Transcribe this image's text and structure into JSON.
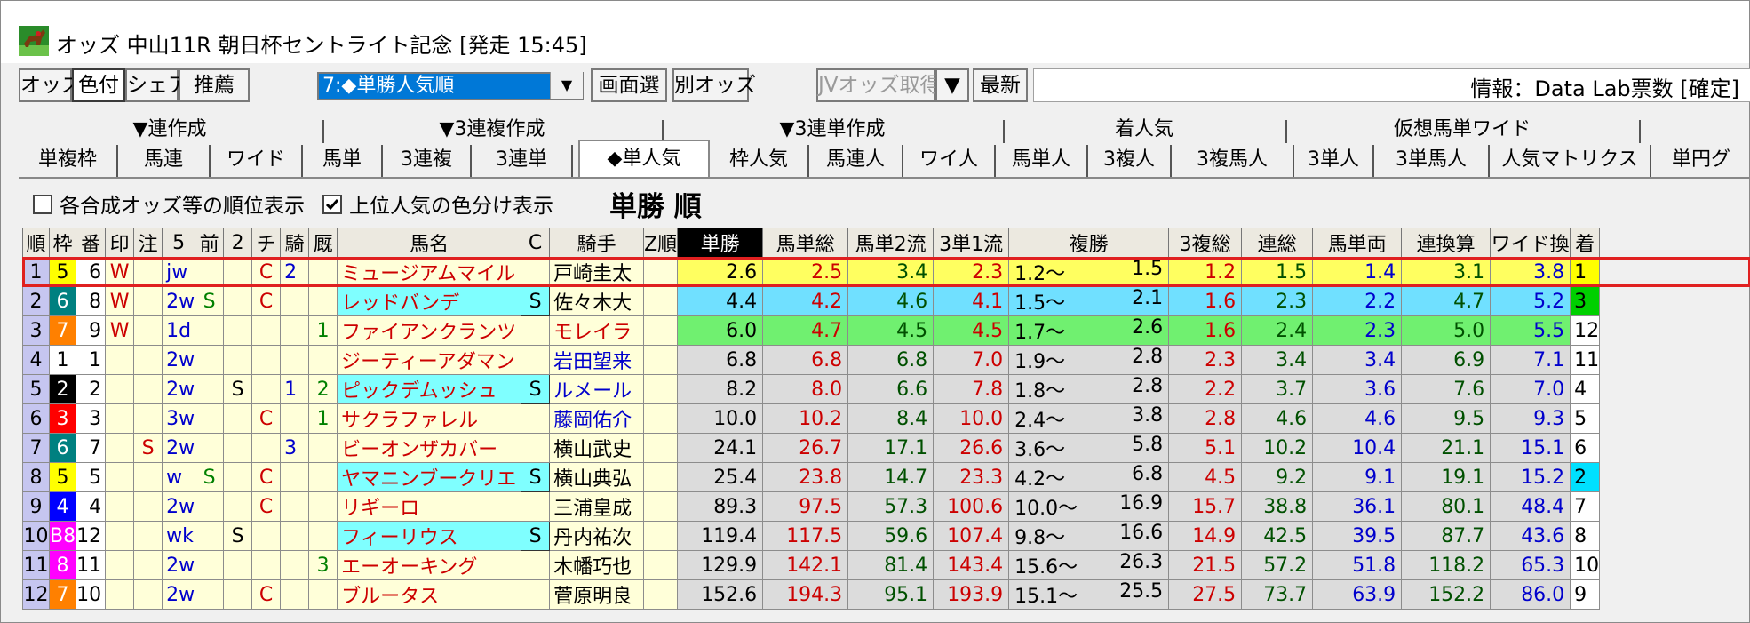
{
  "window": {
    "title": "オッズ 中山11R 朝日杯セントライト記念 [発走 15:45]"
  },
  "toolbar": {
    "buttons": [
      "オッズ",
      "色付",
      "シェア",
      "推薦"
    ],
    "sort_select": "7:◆単勝人気順",
    "screen_select": "画面選",
    "other_odds": "別オッズ",
    "jv_fetch": "JVオッズ取得",
    "dropdown_arrow": "▼",
    "latest": "最新",
    "info": "情報：Data Lab票数 [確定]"
  },
  "tab_groups": [
    "▼連作成",
    "▼3連複作成",
    "▼3連単作成",
    "着人気",
    "仮想馬単ワイド"
  ],
  "tabs": [
    "単複枠",
    "馬連",
    "ワイド",
    "馬単",
    "3連複",
    "3連単",
    "◆単人気",
    "枠人気",
    "馬連人",
    "ワイ人",
    "馬単人",
    "3複人",
    "3複馬人",
    "3単人",
    "3単馬人",
    "人気マトリクス",
    "単円グ"
  ],
  "options": {
    "rank_display": "各合成オッズ等の順位表示",
    "color_display": "上位人気の色分け表示"
  },
  "view_title": "単勝 順",
  "columns": [
    "順",
    "枠",
    "番",
    "印",
    "注",
    "5",
    "前",
    "2",
    "チ",
    "騎",
    "厩",
    "馬名",
    "C",
    "騎手",
    "Z順",
    "単勝",
    "馬単総",
    "馬単2流",
    "3単1流",
    "複勝",
    "3複総",
    "連総",
    "馬単両",
    "連換算",
    "ワイド換",
    "着"
  ],
  "rows": [
    {
      "rank": "1",
      "waku": "5",
      "ban": "6",
      "mark": "W",
      "chu": "",
      "five": "jw",
      "mae": "",
      "two": "",
      "chi": "C",
      "ki": "2",
      "kyu": "",
      "name": "ミュージアムマイル",
      "c": "",
      "jockey": "戸崎圭太",
      "z": "",
      "tan": "2.6",
      "bt": "2.5",
      "b2": "3.4",
      "s1": "2.3",
      "fuku_lo": "1.2〜",
      "fuku_hi": "1.5",
      "f3": "1.2",
      "ren": "1.5",
      "bh": "1.4",
      "rk": "3.1",
      "wk": "3.8",
      "chaku": "1"
    },
    {
      "rank": "2",
      "waku": "6",
      "ban": "8",
      "mark": "W",
      "chu": "",
      "five": "2w",
      "mae": "S",
      "two": "",
      "chi": "C",
      "ki": "",
      "kyu": "",
      "name": "レッドバンデ",
      "c": "S",
      "jockey": "佐々木大",
      "z": "",
      "tan": "4.4",
      "bt": "4.2",
      "b2": "4.6",
      "s1": "4.1",
      "fuku_lo": "1.5〜",
      "fuku_hi": "2.1",
      "f3": "1.6",
      "ren": "2.3",
      "bh": "2.2",
      "rk": "4.7",
      "wk": "5.2",
      "chaku": "3"
    },
    {
      "rank": "3",
      "waku": "7",
      "ban": "9",
      "mark": "W",
      "chu": "",
      "five": "1d",
      "mae": "",
      "two": "",
      "chi": "",
      "ki": "",
      "kyu": "1",
      "name": "ファイアンクランツ",
      "c": "",
      "jockey": "モレイラ",
      "z": "",
      "tan": "6.0",
      "bt": "4.7",
      "b2": "4.5",
      "s1": "4.5",
      "fuku_lo": "1.7〜",
      "fuku_hi": "2.6",
      "f3": "1.6",
      "ren": "2.4",
      "bh": "2.3",
      "rk": "5.0",
      "wk": "5.5",
      "chaku": "12"
    },
    {
      "rank": "4",
      "waku": "1",
      "ban": "1",
      "mark": "",
      "chu": "",
      "five": "2w",
      "mae": "",
      "two": "",
      "chi": "",
      "ki": "",
      "kyu": "",
      "name": "ジーティーアダマン",
      "c": "",
      "jockey": "岩田望来",
      "z": "",
      "tan": "6.8",
      "bt": "6.8",
      "b2": "6.8",
      "s1": "7.0",
      "fuku_lo": "1.9〜",
      "fuku_hi": "2.8",
      "f3": "2.3",
      "ren": "3.4",
      "bh": "3.4",
      "rk": "6.9",
      "wk": "7.1",
      "chaku": "11"
    },
    {
      "rank": "5",
      "waku": "2",
      "ban": "2",
      "mark": "",
      "chu": "",
      "five": "2w",
      "mae": "",
      "two": "S",
      "chi": "",
      "ki": "1",
      "kyu": "2",
      "name": "ピックデムッシュ",
      "c": "S",
      "jockey": "ルメール",
      "z": "",
      "tan": "8.2",
      "bt": "8.0",
      "b2": "6.6",
      "s1": "7.8",
      "fuku_lo": "1.8〜",
      "fuku_hi": "2.8",
      "f3": "2.2",
      "ren": "3.7",
      "bh": "3.6",
      "rk": "7.6",
      "wk": "7.0",
      "chaku": "4"
    },
    {
      "rank": "6",
      "waku": "3",
      "ban": "3",
      "mark": "",
      "chu": "",
      "five": "3w",
      "mae": "",
      "two": "",
      "chi": "C",
      "ki": "",
      "kyu": "1",
      "name": "サクラファレル",
      "c": "",
      "jockey": "藤岡佑介",
      "z": "",
      "tan": "10.0",
      "bt": "10.2",
      "b2": "8.4",
      "s1": "10.0",
      "fuku_lo": "2.4〜",
      "fuku_hi": "3.8",
      "f3": "2.8",
      "ren": "4.6",
      "bh": "4.6",
      "rk": "9.5",
      "wk": "9.3",
      "chaku": "5"
    },
    {
      "rank": "7",
      "waku": "6",
      "ban": "7",
      "mark": "",
      "chu": "S",
      "five": "2w",
      "mae": "",
      "two": "",
      "chi": "",
      "ki": "3",
      "kyu": "",
      "name": "ビーオンザカバー",
      "c": "",
      "jockey": "横山武史",
      "z": "",
      "tan": "24.1",
      "bt": "26.7",
      "b2": "17.1",
      "s1": "26.6",
      "fuku_lo": "3.6〜",
      "fuku_hi": "5.8",
      "f3": "5.1",
      "ren": "10.2",
      "bh": "10.4",
      "rk": "21.1",
      "wk": "15.1",
      "chaku": "6"
    },
    {
      "rank": "8",
      "waku": "5",
      "ban": "5",
      "mark": "",
      "chu": "",
      "five": "w",
      "mae": "S",
      "two": "",
      "chi": "C",
      "ki": "",
      "kyu": "",
      "name": "ヤマニンブークリエ",
      "c": "S",
      "jockey": "横山典弘",
      "z": "",
      "tan": "25.4",
      "bt": "23.8",
      "b2": "14.7",
      "s1": "23.3",
      "fuku_lo": "4.2〜",
      "fuku_hi": "6.8",
      "f3": "4.5",
      "ren": "9.2",
      "bh": "9.1",
      "rk": "19.1",
      "wk": "15.2",
      "chaku": "2"
    },
    {
      "rank": "9",
      "waku": "4",
      "ban": "4",
      "mark": "",
      "chu": "",
      "five": "2w",
      "mae": "",
      "two": "",
      "chi": "C",
      "ki": "",
      "kyu": "",
      "name": "リギーロ",
      "c": "",
      "jockey": "三浦皇成",
      "z": "",
      "tan": "89.3",
      "bt": "97.5",
      "b2": "57.3",
      "s1": "100.6",
      "fuku_lo": "10.0〜",
      "fuku_hi": "16.9",
      "f3": "15.7",
      "ren": "38.8",
      "bh": "36.1",
      "rk": "80.1",
      "wk": "48.4",
      "chaku": "7"
    },
    {
      "rank": "10",
      "waku": "B8",
      "ban": "12",
      "mark": "",
      "chu": "",
      "five": "wk",
      "mae": "",
      "two": "S",
      "chi": "",
      "ki": "",
      "kyu": "",
      "name": "フィーリウス",
      "c": "S",
      "jockey": "丹内祐次",
      "z": "",
      "tan": "119.4",
      "bt": "117.5",
      "b2": "59.6",
      "s1": "107.4",
      "fuku_lo": "9.8〜",
      "fuku_hi": "16.6",
      "f3": "14.9",
      "ren": "42.5",
      "bh": "39.5",
      "rk": "87.7",
      "wk": "43.6",
      "chaku": "8"
    },
    {
      "rank": "11",
      "waku": "8",
      "ban": "11",
      "mark": "",
      "chu": "",
      "five": "2w",
      "mae": "",
      "two": "",
      "chi": "",
      "ki": "",
      "kyu": "3",
      "name": "エーオーキング",
      "c": "",
      "jockey": "木幡巧也",
      "z": "",
      "tan": "129.9",
      "bt": "142.1",
      "b2": "81.4",
      "s1": "143.4",
      "fuku_lo": "15.6〜",
      "fuku_hi": "26.3",
      "f3": "21.5",
      "ren": "57.2",
      "bh": "51.8",
      "rk": "118.2",
      "wk": "65.3",
      "chaku": "10"
    },
    {
      "rank": "12",
      "waku": "7",
      "ban": "10",
      "mark": "",
      "chu": "",
      "five": "2w",
      "mae": "",
      "two": "",
      "chi": "C",
      "ki": "",
      "kyu": "",
      "name": "ブルータス",
      "c": "",
      "jockey": "菅原明良",
      "z": "",
      "tan": "152.6",
      "bt": "194.3",
      "b2": "95.1",
      "s1": "193.9",
      "fuku_lo": "15.1〜",
      "fuku_hi": "25.5",
      "f3": "27.5",
      "ren": "73.7",
      "bh": "63.9",
      "rk": "152.2",
      "wk": "86.0",
      "chaku": "9"
    }
  ],
  "colors": {
    "waku": {
      "1": "#ffffff",
      "2": "#000000",
      "3": "#ff0000",
      "4": "#0000ff",
      "5": "#ffff00",
      "6": "#008080",
      "7": "#ff8000",
      "8": "#ff00ff",
      "B8": "#ff00ff"
    },
    "pop1": "#ffff60",
    "pop2": "#70e0ff",
    "pop3": "#70f070",
    "default": "#dcdcdc",
    "selected_row_border": "#e02020"
  }
}
